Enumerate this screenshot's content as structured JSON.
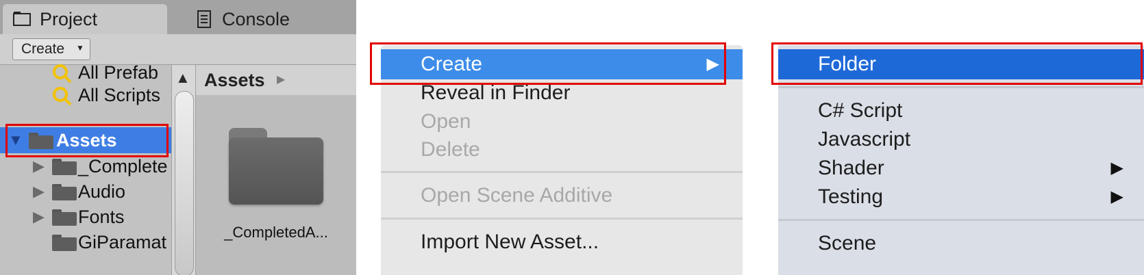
{
  "project_window": {
    "tabs": [
      {
        "label": "Project",
        "icon": "folder-icon"
      },
      {
        "label": "Console",
        "icon": "console-icon"
      }
    ],
    "toolbar": {
      "create_label": "Create"
    },
    "tree": {
      "favorites": [
        "All Prefab",
        "All Scripts"
      ],
      "root": "Assets",
      "children": [
        "_Complete",
        "Audio",
        "Fonts",
        "GiParamat"
      ]
    },
    "breadcrumb": "Assets",
    "grid_items": [
      {
        "label": "_CompletedA..."
      }
    ]
  },
  "context_menu": {
    "items": [
      {
        "label": "Create",
        "state": "highlighted",
        "submenu": true
      },
      {
        "label": "Reveal in Finder",
        "state": "enabled"
      },
      {
        "label": "Open",
        "state": "disabled"
      },
      {
        "label": "Delete",
        "state": "disabled"
      },
      {
        "label": "Open Scene Additive",
        "state": "disabled"
      },
      {
        "label": "Import New Asset...",
        "state": "enabled"
      }
    ]
  },
  "create_submenu": {
    "items": [
      {
        "label": "Folder",
        "state": "highlighted"
      },
      {
        "label": "C# Script",
        "state": "enabled"
      },
      {
        "label": "Javascript",
        "state": "enabled"
      },
      {
        "label": "Shader",
        "state": "enabled",
        "submenu": true
      },
      {
        "label": "Testing",
        "state": "enabled",
        "submenu": true
      },
      {
        "label": "Scene",
        "state": "enabled"
      }
    ]
  },
  "colors": {
    "highlight_outline": "#e20000",
    "selection_blue": "#3e7de3",
    "menu_highlight": "#3d8ce9",
    "submenu_highlight": "#1e69d8"
  }
}
